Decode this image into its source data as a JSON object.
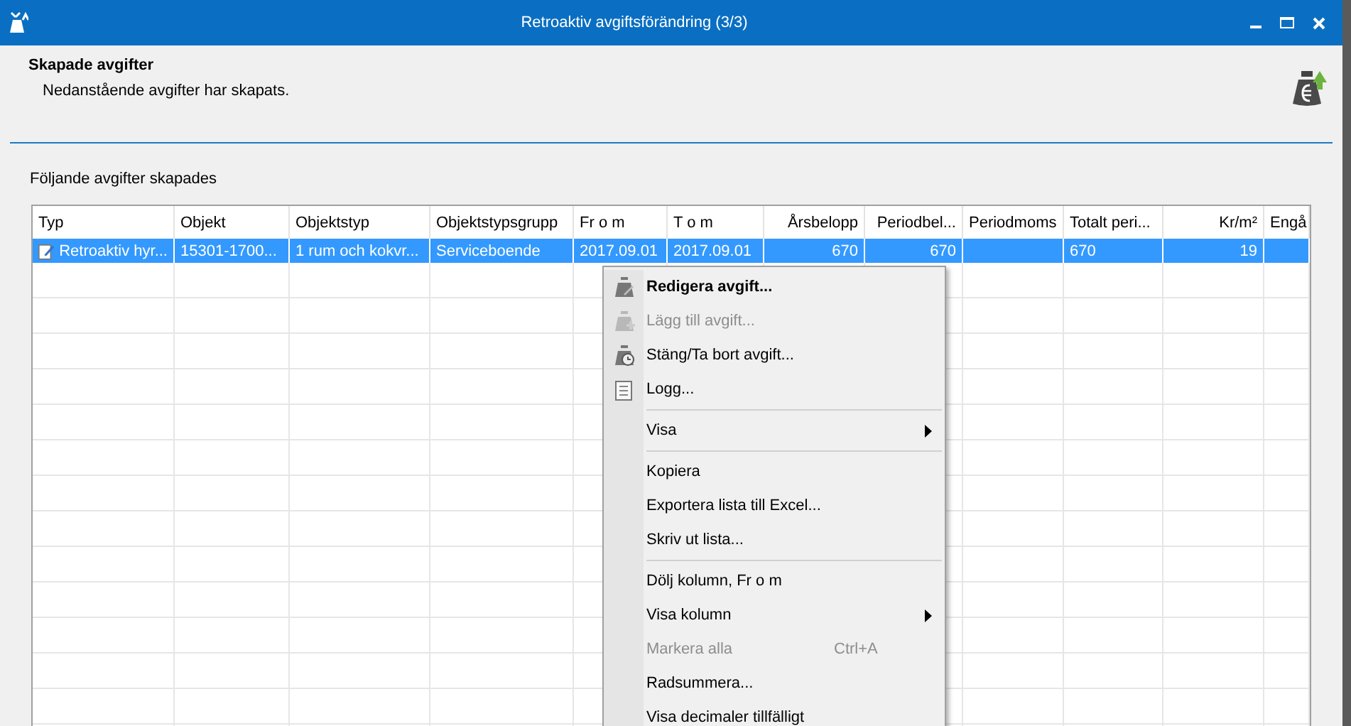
{
  "window": {
    "title": "Retroaktiv avgiftsförändring (3/3)"
  },
  "header": {
    "title": "Skapade avgifter",
    "subtitle": "Nedanstående avgifter har skapats."
  },
  "section_label": "Följande avgifter skapades",
  "table": {
    "columns": [
      "Typ",
      "Objekt",
      "Objektstyp",
      "Objektstypsgrupp",
      "Fr o m",
      "T o m",
      "Årsbelopp",
      "Periodbel...",
      "Periodmoms",
      "Totalt peri...",
      "Kr/m²",
      "Engå"
    ],
    "rows": [
      {
        "selected": true,
        "cells": [
          "Retroaktiv hyr...",
          "15301-1700...",
          "1 rum och kokvr...",
          "Serviceboende",
          "2017.09.01",
          "2017.09.01",
          "670",
          "670",
          "",
          "670",
          "19",
          ""
        ]
      }
    ]
  },
  "context_menu": [
    {
      "kind": "item",
      "label": "Redigera avgift...",
      "bold": true,
      "disabled": false
    },
    {
      "kind": "item",
      "label": "Lägg till avgift...",
      "bold": false,
      "disabled": true
    },
    {
      "kind": "item",
      "label": "Stäng/Ta bort avgift...",
      "bold": false,
      "disabled": false
    },
    {
      "kind": "item",
      "label": "Logg...",
      "bold": false,
      "disabled": false
    },
    {
      "kind": "separator"
    },
    {
      "kind": "submenu",
      "label": "Visa",
      "disabled": false
    },
    {
      "kind": "separator"
    },
    {
      "kind": "item",
      "label": "Kopiera",
      "bold": false,
      "disabled": false
    },
    {
      "kind": "item",
      "label": "Exportera lista till Excel...",
      "bold": false,
      "disabled": false
    },
    {
      "kind": "item",
      "label": "Skriv ut lista...",
      "bold": false,
      "disabled": false
    },
    {
      "kind": "separator"
    },
    {
      "kind": "item",
      "label": "Dölj kolumn, Fr o m",
      "bold": false,
      "disabled": false
    },
    {
      "kind": "submenu",
      "label": "Visa kolumn",
      "disabled": false
    },
    {
      "kind": "item",
      "label": "Markera alla",
      "shortcut": "Ctrl+A",
      "bold": false,
      "disabled": true
    },
    {
      "kind": "item",
      "label": "Radsummera...",
      "bold": false,
      "disabled": false
    },
    {
      "kind": "item",
      "label": "Visa decimaler tillfälligt",
      "bold": false,
      "disabled": false
    }
  ]
}
